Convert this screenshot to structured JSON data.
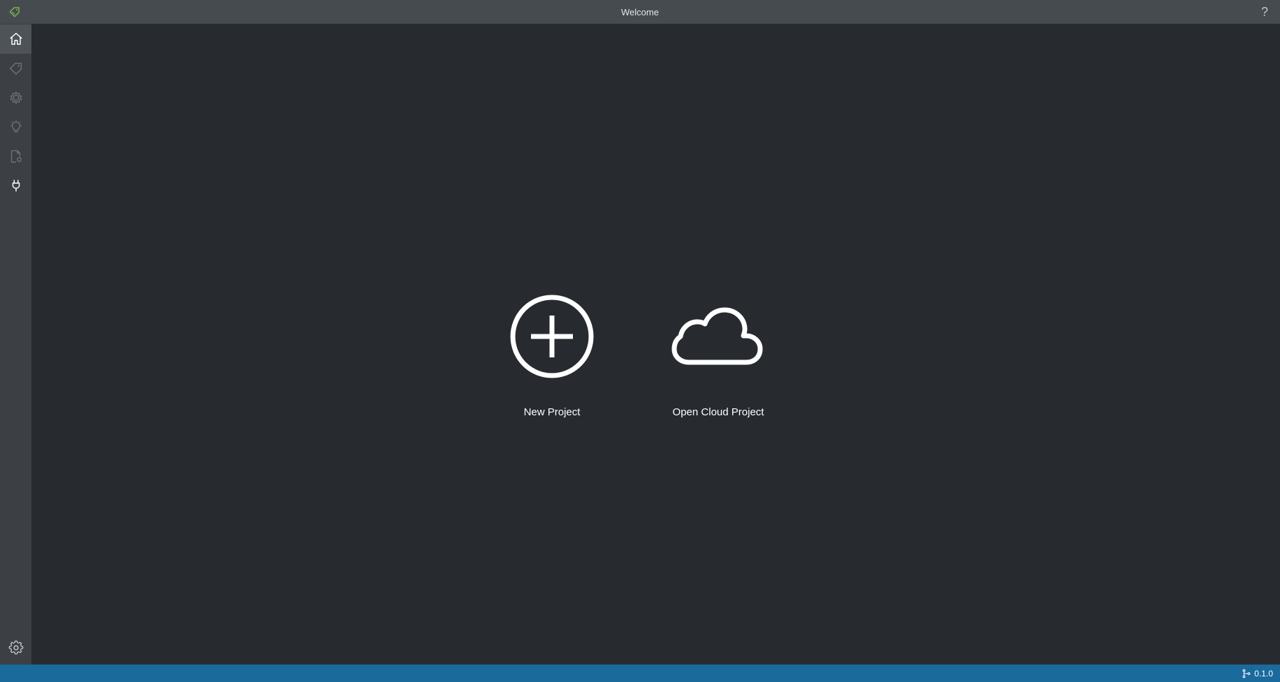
{
  "window": {
    "title": "Welcome",
    "help_label": "?"
  },
  "sidebar": {
    "items": [
      {
        "name": "home",
        "icon": "home-icon",
        "active": true
      },
      {
        "name": "tags",
        "icon": "tag-icon",
        "active": false
      },
      {
        "name": "settings-sync",
        "icon": "gear-star-icon",
        "active": false
      },
      {
        "name": "active-learning",
        "icon": "lightbulb-icon",
        "active": false
      },
      {
        "name": "export",
        "icon": "document-gear-icon",
        "active": false
      },
      {
        "name": "connections",
        "icon": "plug-icon",
        "active": false
      }
    ],
    "bottom_item": {
      "name": "settings",
      "icon": "gear-icon"
    }
  },
  "main": {
    "actions": [
      {
        "label": "New Project",
        "icon": "plus-circle-icon"
      },
      {
        "label": "Open Cloud Project",
        "icon": "cloud-icon"
      }
    ]
  },
  "statusbar": {
    "version": "0.1.0",
    "icon": "branch-icon"
  },
  "colors": {
    "titlebar": "#464b50",
    "sidebar": "#3c4045",
    "background": "#272b30",
    "statusbar": "#1a6b9c",
    "accent": "#7ab648"
  }
}
